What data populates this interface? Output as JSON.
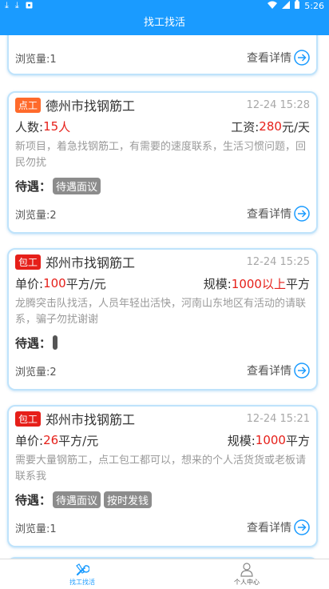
{
  "status_bar": {
    "time": "5:26",
    "left_icons": [
      "download-icon",
      "download-icon",
      "square-icon"
    ],
    "right_icons": [
      "wifi-icon",
      "signal-icon",
      "battery-icon"
    ]
  },
  "header": {
    "title": "找工找活"
  },
  "detail_label": "查看详情",
  "benefits_label": "待遇：",
  "partial_top_card": {
    "views": "浏览量:1"
  },
  "cards": [
    {
      "badge": "点工",
      "title": "德州市找钢筋工",
      "time": "12-24 15:28",
      "left_key": "人数: ",
      "left_value": "15",
      "left_unit": "人",
      "right_key": "工资: ",
      "right_value": "280",
      "right_unit": "元/天",
      "desc": "新项目，着急找钢筋工，有需要的速度联系，生活习惯问题，回民勿扰",
      "tags": [
        "待遇面议"
      ],
      "views": "浏览量:2"
    },
    {
      "badge": "包工",
      "title": "郑州市找钢筋工",
      "time": "12-24 15:25",
      "left_key": "单价: ",
      "left_value": "100",
      "left_unit": "平方/元",
      "right_key": "规模: ",
      "right_value": "1000以上",
      "right_unit": "平方",
      "desc": "龙腾突击队找活，人员年轻出活快，河南山东地区有活动的请联系，骗子勿扰谢谢",
      "tags": [],
      "views": "浏览量:2"
    },
    {
      "badge": "包工",
      "title": "郑州市找钢筋工",
      "time": "12-24 15:21",
      "left_key": "单价: ",
      "left_value": "26",
      "left_unit": "平方/元",
      "right_key": "规模: ",
      "right_value": "1000",
      "right_unit": "平方",
      "desc": "需要大量钢筋工，点工包工都可以，想来的个人活货货或老板请联系我",
      "tags": [
        "待遇面议",
        "按时发钱"
      ],
      "views": "浏览量:1"
    }
  ],
  "bottom_nav": [
    {
      "label": "找工找活",
      "icon": "tools-icon",
      "active": true
    },
    {
      "label": "个人中心",
      "icon": "person-icon",
      "active": false
    }
  ],
  "colors": {
    "primary": "#1a9bff",
    "accent_red": "#e61f19",
    "badge_orange": "#ff6a2b",
    "card_border": "#bfe3fb"
  }
}
